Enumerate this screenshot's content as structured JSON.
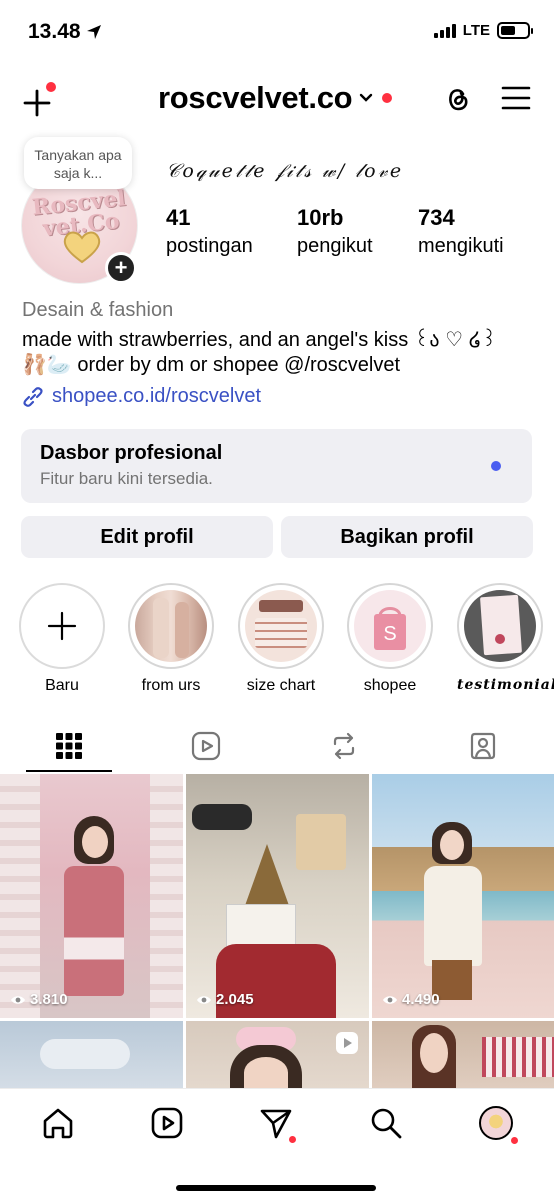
{
  "status_bar": {
    "time": "13.48",
    "network": "LTE"
  },
  "header": {
    "username": "roscvelvet.co"
  },
  "profile": {
    "note": "Tanyakan apa saja k...",
    "avatar_text": "Roscvel vet.Co",
    "display_name": "𝒞𝑜𝓆𝓊𝑒𝓉𝓉𝑒 𝒻𝒾𝓉𝓈 𝓌/ 𝓁𝑜𝓋𝑒",
    "stats": [
      {
        "value": "41",
        "label": "postingan"
      },
      {
        "value": "10rb",
        "label": "pengikut"
      },
      {
        "value": "734",
        "label": "mengikuti"
      }
    ],
    "category": "Desain & fashion",
    "bio_line1": "made with strawberries, and an angel's kiss ꒰ა ♡ ໒꒱",
    "bio_line2_emoji": "🩰🦢",
    "bio_line2": " order by dm or shopee @/roscvelvet",
    "link": "shopee.co.id/roscvelvet"
  },
  "dashboard": {
    "title": "Dasbor profesional",
    "subtitle": "Fitur baru kini tersedia."
  },
  "buttons": {
    "edit": "Edit profil",
    "share": "Bagikan profil"
  },
  "highlights": [
    {
      "label": "Baru"
    },
    {
      "label": "from urs"
    },
    {
      "label": "size chart"
    },
    {
      "label": "shopee"
    },
    {
      "label": "testimonial"
    }
  ],
  "posts": [
    {
      "views": "3.810"
    },
    {
      "views": "2.045"
    },
    {
      "views": "4.490"
    },
    {
      "views": ""
    },
    {
      "views": ""
    },
    {
      "views": ""
    }
  ],
  "colors": {
    "accent_link": "#3a51c4",
    "notification_red": "#ff3040",
    "dashboard_dot": "#4a5df0",
    "button_bg": "#efeff3"
  }
}
